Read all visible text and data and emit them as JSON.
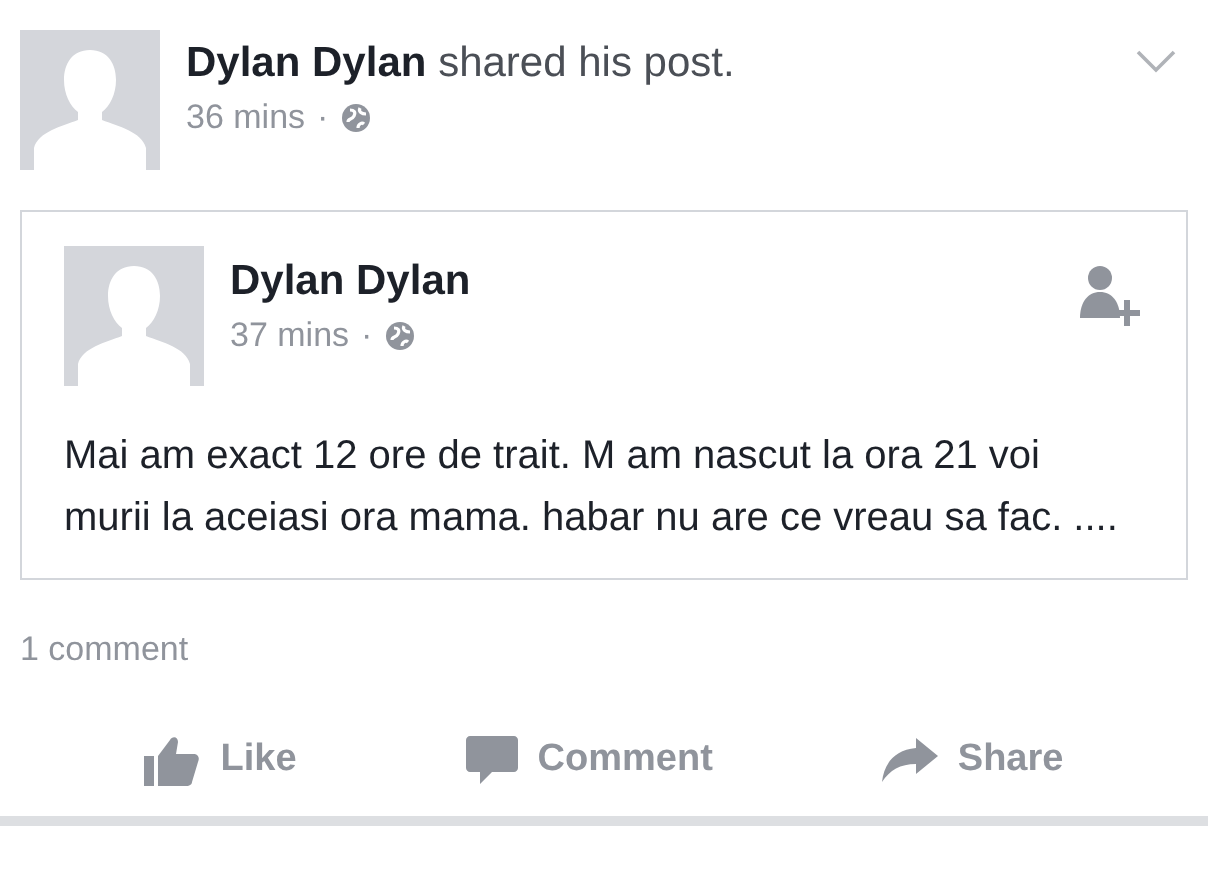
{
  "header": {
    "author": "Dylan Dylan",
    "action": "shared his post.",
    "time": "36 mins",
    "separator": "·"
  },
  "shared_post": {
    "author": "Dylan Dylan",
    "time": "37 mins",
    "separator": "·",
    "text": "Mai am exact 12 ore de trait. M am nascut la ora 21 voi murii la aceiasi ora mama. habar nu are ce vreau sa fac. ...."
  },
  "comment_count": "1 comment",
  "actions": [
    {
      "kind": "like",
      "label": "Like"
    },
    {
      "kind": "comment",
      "label": "Comment"
    },
    {
      "kind": "share",
      "label": "Share"
    }
  ]
}
